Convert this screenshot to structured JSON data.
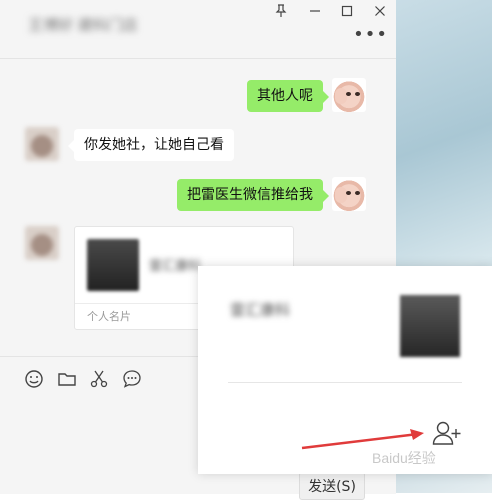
{
  "chat": {
    "contact_name": "王博好 建科门店",
    "window_controls": [
      "pin-icon",
      "minimize-icon",
      "maximize-icon",
      "close-icon"
    ],
    "more_label": "•••",
    "messages": [
      {
        "direction": "out",
        "type": "text",
        "text": "其他人呢"
      },
      {
        "direction": "in",
        "type": "text",
        "text": "你发她社，让她自己看"
      },
      {
        "direction": "out",
        "type": "text",
        "text": "把雷医生微信推给我"
      },
      {
        "direction": "in",
        "type": "card",
        "card_name": "雷汇康科",
        "card_label": "个人名片"
      }
    ]
  },
  "toolbar": {
    "icons": [
      "emoji-icon",
      "folder-icon",
      "scissors-icon",
      "chat-history-icon"
    ],
    "send_label": "发送(S)"
  },
  "popup": {
    "name": "雷汇康科",
    "add_friend_icon": "add-friend-icon"
  },
  "watermark": "Baidu经验",
  "colors": {
    "out_bubble": "#95ec69",
    "in_bubble": "#ffffff",
    "arrow": "#e03b3b"
  }
}
